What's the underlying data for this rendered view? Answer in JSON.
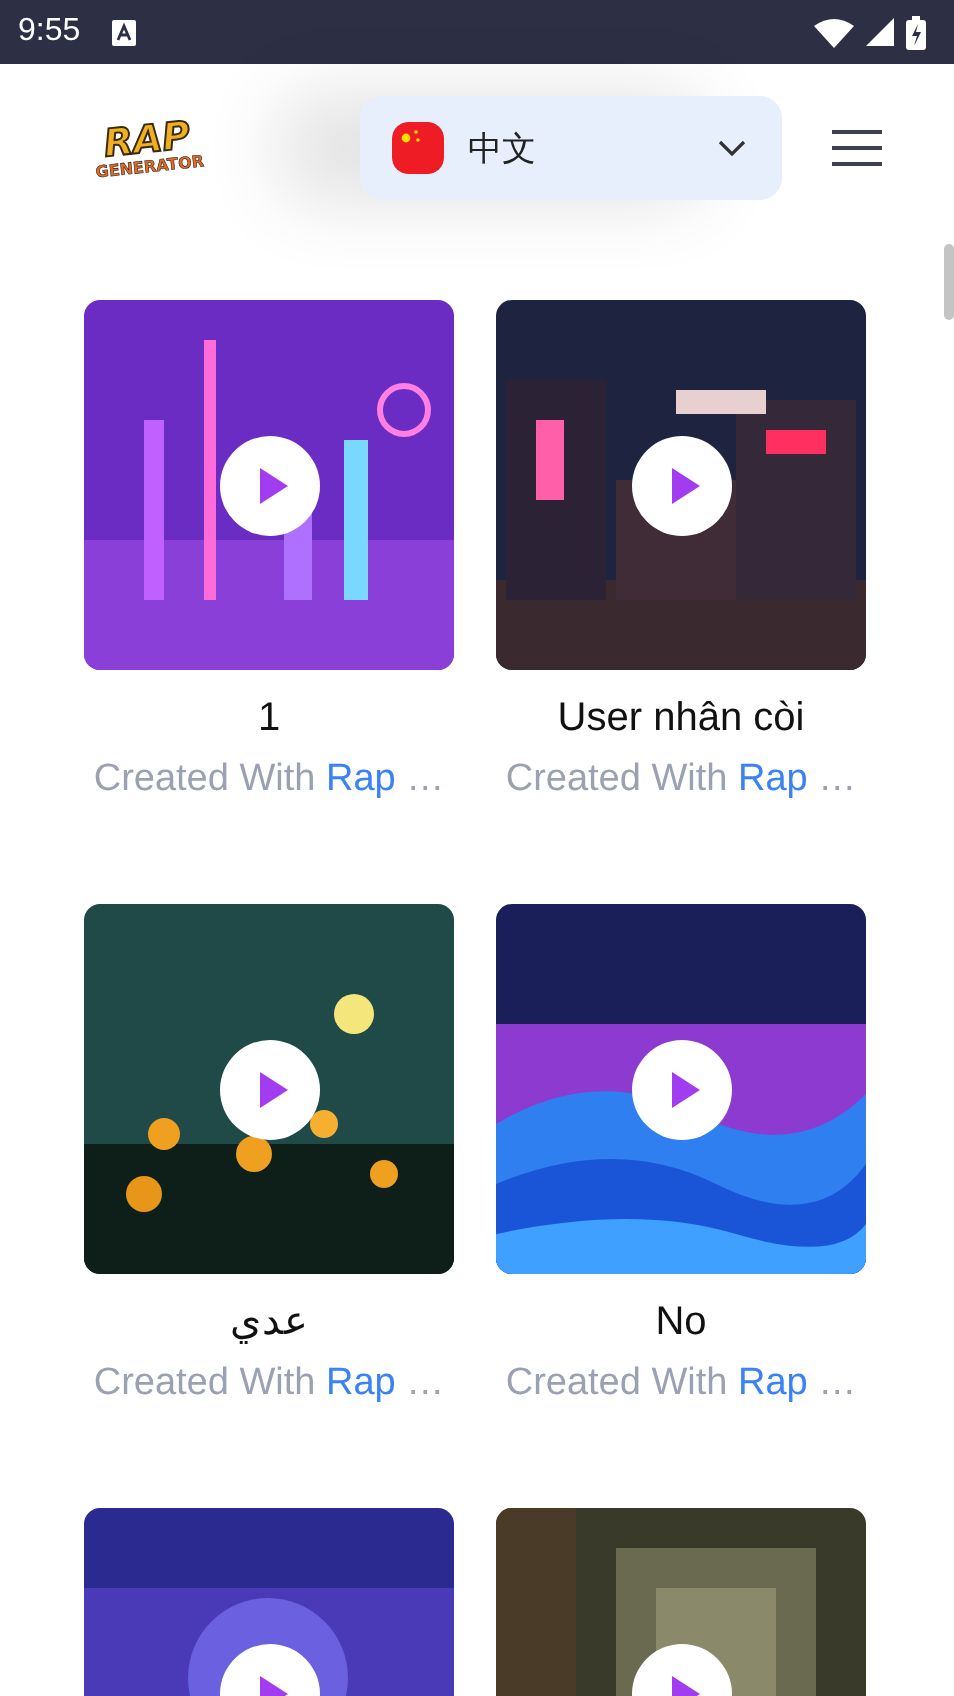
{
  "status_bar": {
    "time": "9:55"
  },
  "header": {
    "logo": {
      "line_1": "RAP",
      "line_2": "GENERATOR"
    },
    "language": {
      "label": "中文"
    }
  },
  "cards": [
    {
      "kind": "song",
      "title": "1",
      "caption": "Created With",
      "link": "Rap",
      "ellipsis": "…"
    },
    {
      "kind": "song",
      "title": "User nhân còi",
      "caption": "Created With",
      "link": "Rap",
      "ellipsis": "…"
    },
    {
      "kind": "song",
      "title": "عدي",
      "caption": "Created With",
      "link": "Rap",
      "ellipsis": "…"
    },
    {
      "kind": "song",
      "title": "No",
      "caption": "Created With",
      "link": "Rap",
      "ellipsis": "…"
    },
    {
      "kind": "picture"
    },
    {
      "kind": "picture"
    }
  ]
}
